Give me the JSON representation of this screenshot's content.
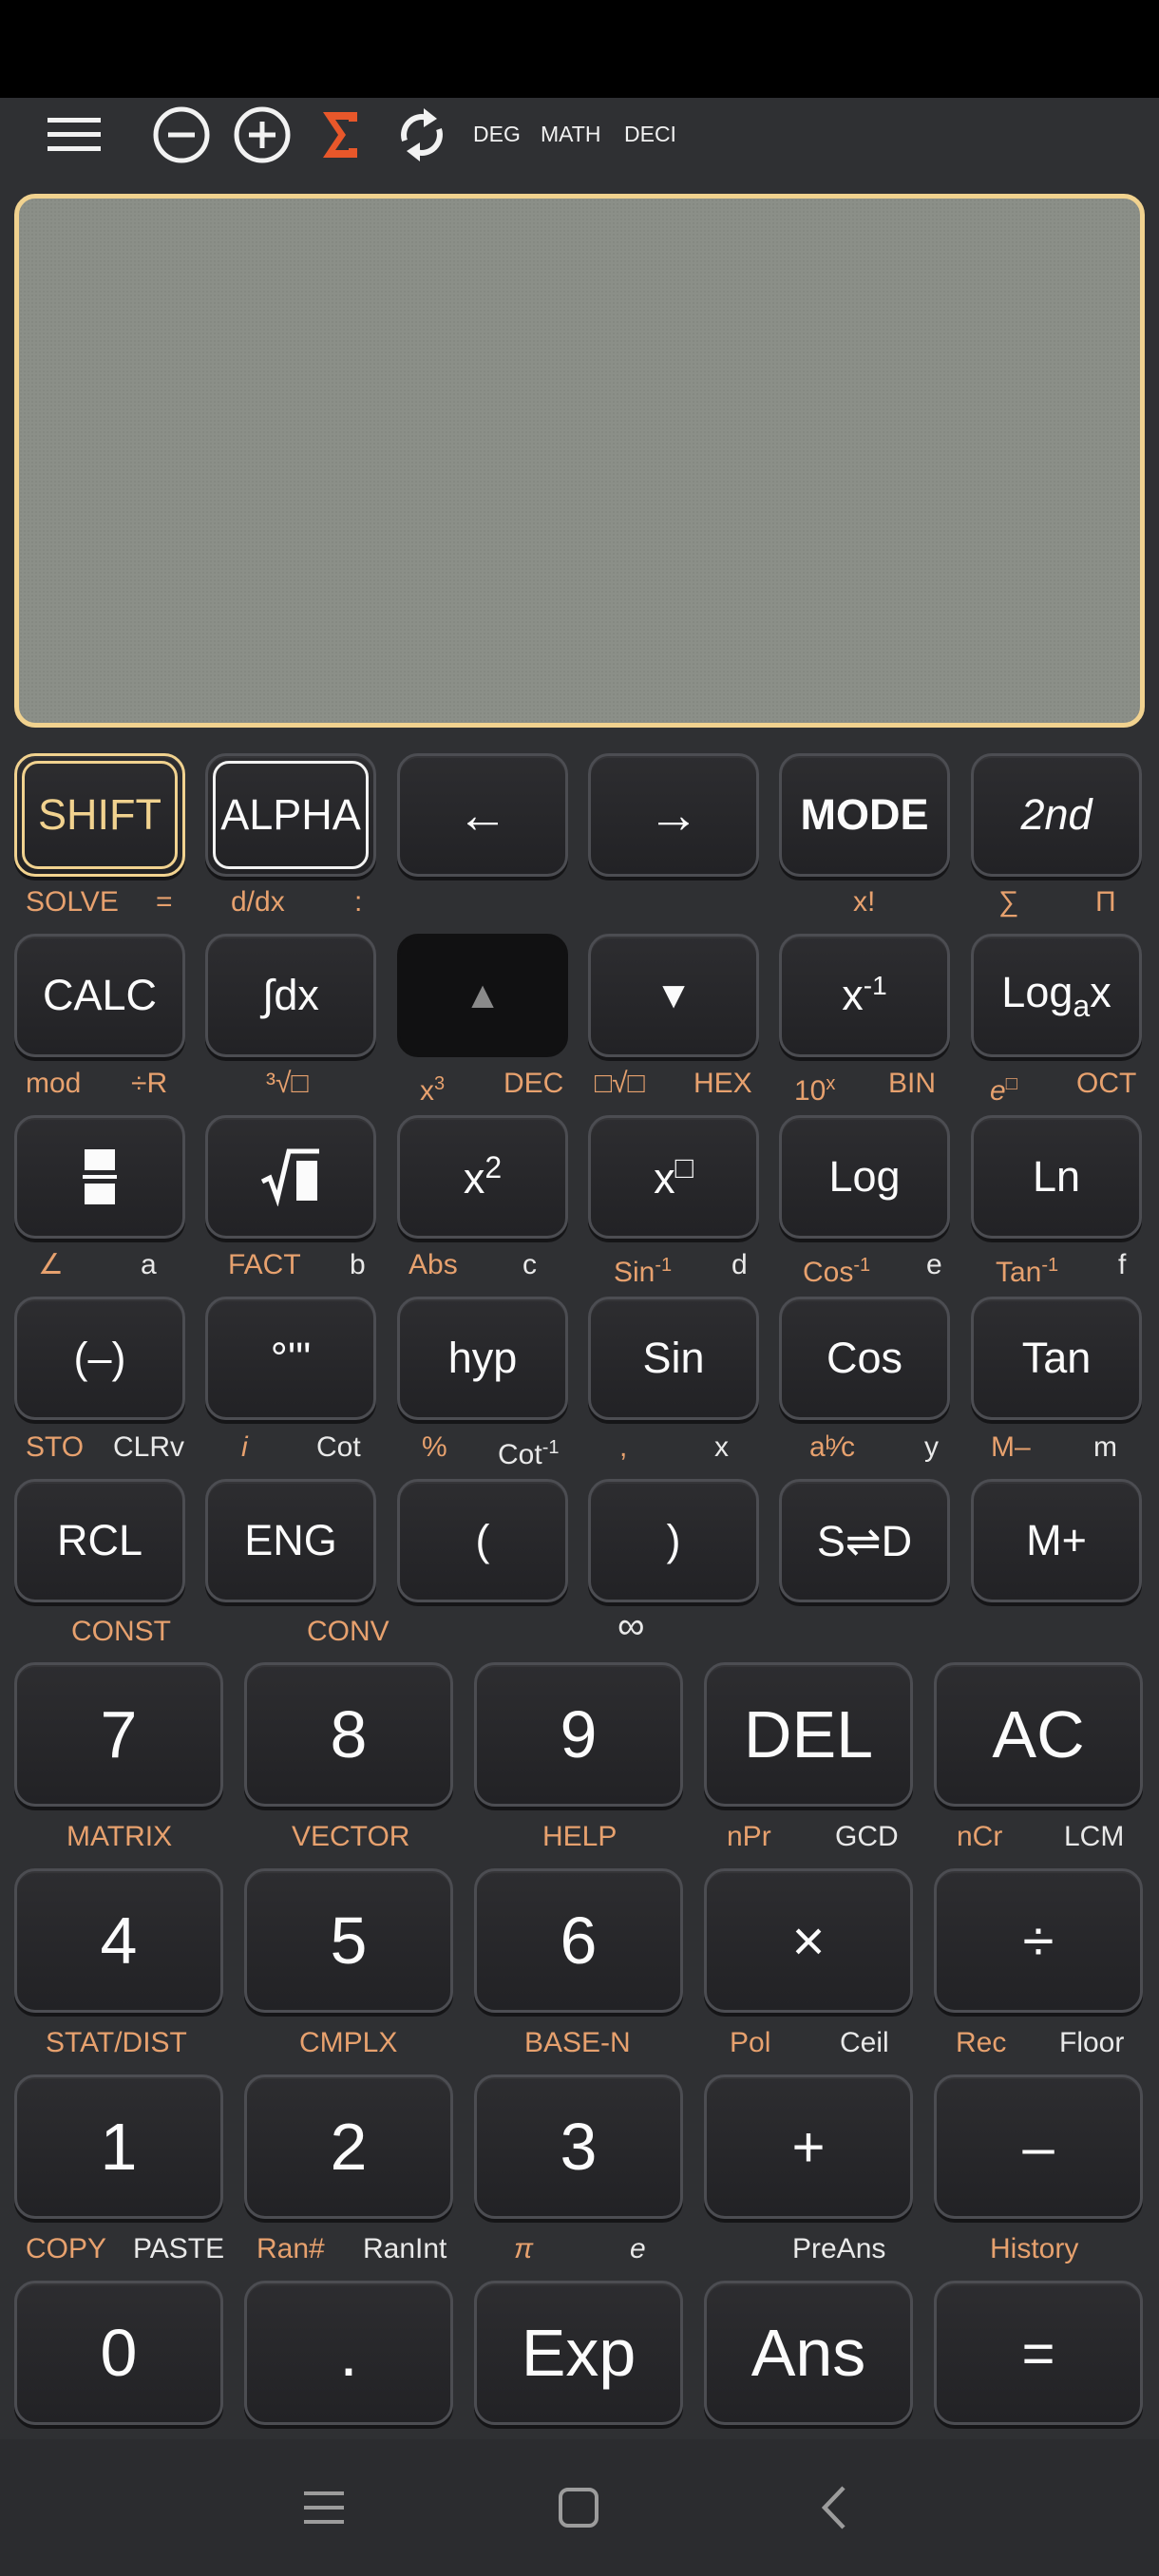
{
  "topbar": {
    "menu_icon": "menu-icon",
    "minus_icon": "circle-minus-icon",
    "plus_icon": "circle-plus-icon",
    "sigma_icon": "sigma-icon",
    "refresh_icon": "refresh-icon",
    "angle_mode": "DEG",
    "input_mode": "MATH",
    "number_format": "DECI",
    "sigma_color": "#e8572a"
  },
  "display": {
    "border_color": "#f1d28f",
    "background_color": "#8b8f88",
    "content": ""
  },
  "row1": {
    "shift": "SHIFT",
    "alpha": "ALPHA",
    "left_arrow": "←",
    "right_arrow": "→",
    "mode": "MODE",
    "second": "2nd"
  },
  "row1_labels": {
    "solve": "SOLVE",
    "equals": "=",
    "ddx": "d/dx",
    "colon": ":",
    "factorial": "x!",
    "sum": "∑",
    "product": "Π"
  },
  "row2": {
    "calc": "CALC",
    "integral": "∫dx",
    "up": "▲",
    "down": "▼",
    "inverse": "x",
    "inverse_sup": "-1",
    "loga": "Log",
    "loga_sub": "a",
    "loga_x": "x"
  },
  "row2_labels": {
    "mod": "mod",
    "div_r": "÷R",
    "cube_root": "³√□",
    "x_cubed": "x",
    "x_cubed_sup": "3",
    "dec": "DEC",
    "nth_root": "□√□",
    "hex": "HEX",
    "ten_pow": "10",
    "ten_pow_sup": "x",
    "bin": "BIN",
    "e_pow": "e",
    "e_pow_sup": "□",
    "oct": "OCT"
  },
  "row3": {
    "square": "x",
    "square_sup": "2",
    "power": "x",
    "power_sup": "□",
    "log": "Log",
    "ln": "Ln"
  },
  "row3_labels": {
    "angle": "∠",
    "a": "a",
    "fact": "FACT",
    "b": "b",
    "abs": "Abs",
    "c": "c",
    "asin": "Sin",
    "asin_sup": "-1",
    "d": "d",
    "acos": "Cos",
    "acos_sup": "-1",
    "e": "e",
    "atan": "Tan",
    "atan_sup": "-1",
    "f": "f"
  },
  "row4": {
    "negative": "(–)",
    "degrees": "°'\"",
    "hyp": "hyp",
    "sin": "Sin",
    "cos": "Cos",
    "tan": "Tan"
  },
  "row4_labels": {
    "sto": "STO",
    "clrv": "CLRv",
    "imag": "i",
    "cot": "Cot",
    "percent": "%",
    "acot": "Cot",
    "acot_sup": "-1",
    "comma": ",",
    "x": "x",
    "abc": "aᵇ⁄c",
    "y": "y",
    "m_minus": "M–",
    "m": "m"
  },
  "row5": {
    "rcl": "RCL",
    "eng": "ENG",
    "open_paren": "(",
    "close_paren": ")",
    "std": "S⇌D",
    "m_plus": "M+"
  },
  "row5_labels": {
    "const": "CONST",
    "conv": "CONV",
    "infinity": "∞"
  },
  "row6": {
    "seven": "7",
    "eight": "8",
    "nine": "9",
    "del": "DEL",
    "ac": "AC"
  },
  "row6_labels": {
    "matrix": "MATRIX",
    "vector": "VECTOR",
    "help": "HELP",
    "npr": "nPr",
    "gcd": "GCD",
    "ncr": "nCr",
    "lcm": "LCM"
  },
  "row7": {
    "four": "4",
    "five": "5",
    "six": "6",
    "multiply": "×",
    "divide": "÷"
  },
  "row7_labels": {
    "stat": "STAT/DIST",
    "cmplx": "CMPLX",
    "base_n": "BASE-N",
    "pol": "Pol",
    "ceil": "Ceil",
    "rec": "Rec",
    "floor": "Floor"
  },
  "row8": {
    "one": "1",
    "two": "2",
    "three": "3",
    "plus": "+",
    "minus": "–"
  },
  "row8_labels": {
    "copy": "COPY",
    "paste": "PASTE",
    "ran": "Ran#",
    "ranint": "RanInt",
    "pi": "π",
    "e_const": "e",
    "preans": "PreAns",
    "history": "History"
  },
  "row9": {
    "zero": "0",
    "dot": ".",
    "exp": "Exp",
    "ans": "Ans",
    "equals": "="
  },
  "navbar": {
    "recents_icon": "recents-icon",
    "home_icon": "home-icon",
    "back_icon": "back-icon"
  },
  "colors": {
    "secondary_orange": "#e7a16e",
    "secondary_white": "#e9e9e9",
    "key_border": "#4c4d52",
    "background": "#2f3033"
  }
}
